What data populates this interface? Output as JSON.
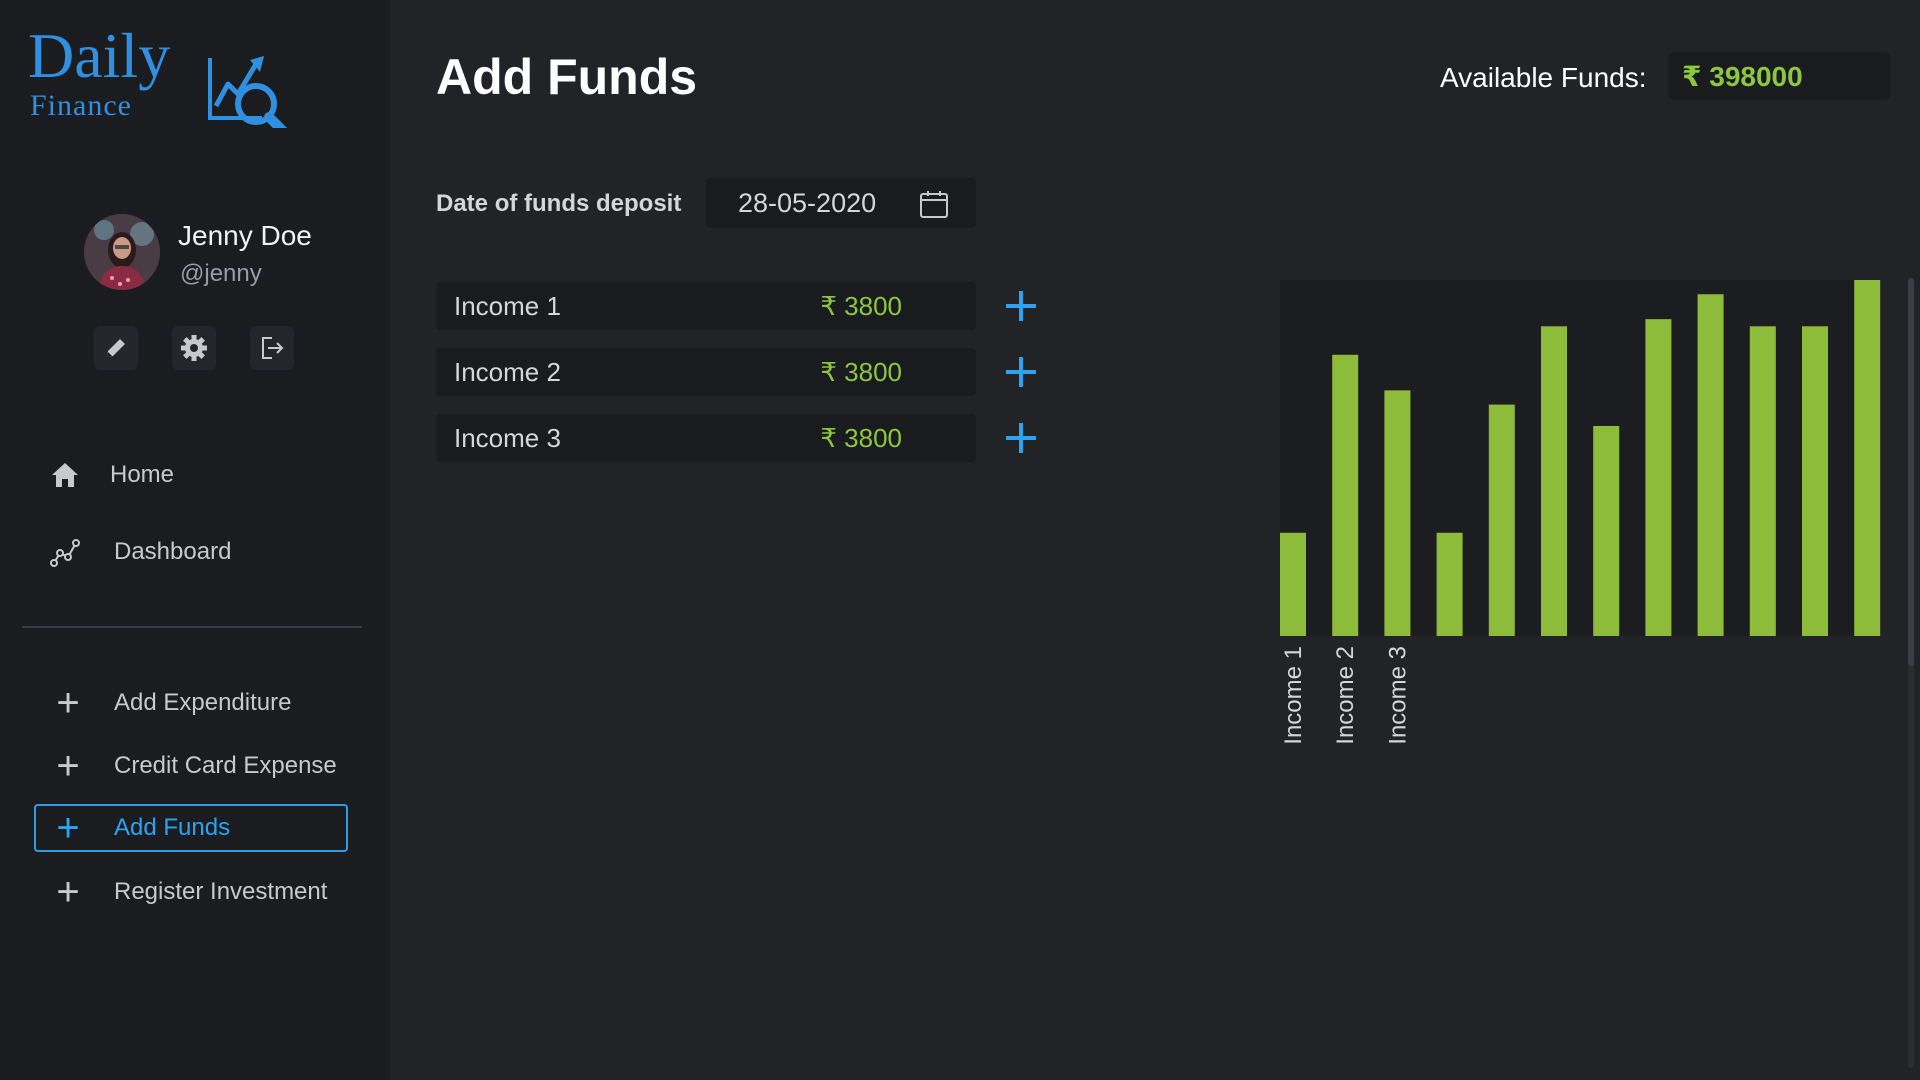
{
  "app": {
    "logo_main": "Daily",
    "logo_sub": "Finance"
  },
  "user": {
    "name": "Jenny Doe",
    "handle": "@jenny"
  },
  "profile_actions": [
    "edit-icon",
    "gear-icon",
    "logout-icon"
  ],
  "nav": {
    "home": "Home",
    "dashboard": "Dashboard"
  },
  "actions": {
    "add_expenditure": "Add Expenditure",
    "credit_card_expense": "Credit Card Expense",
    "add_funds": "Add Funds",
    "register_investment": "Register Investment"
  },
  "header": {
    "title": "Add Funds",
    "available_funds_label": "Available Funds:",
    "available_funds_value": "₹ 398000"
  },
  "deposit": {
    "label": "Date of funds deposit",
    "date": "28-05-2020"
  },
  "incomes": [
    {
      "label": "Income 1",
      "amount": "₹ 3800"
    },
    {
      "label": "Income 2",
      "amount": "₹ 3800"
    },
    {
      "label": "Income 3",
      "amount": "₹ 3800"
    }
  ],
  "colors": {
    "accent": "#2ba3f0",
    "money": "#8dc63f",
    "bar": "#8dbb3a"
  },
  "chart_data": {
    "type": "bar",
    "categories": [
      "Income 1",
      "Income 2",
      "Income 3",
      "",
      "",
      "",
      "",
      "",
      "",
      "",
      "",
      ""
    ],
    "values": [
      29,
      79,
      69,
      29,
      65,
      87,
      59,
      89,
      96,
      87,
      87,
      100
    ],
    "ylim": [
      0,
      100
    ],
    "grid": false,
    "legend": "none"
  }
}
